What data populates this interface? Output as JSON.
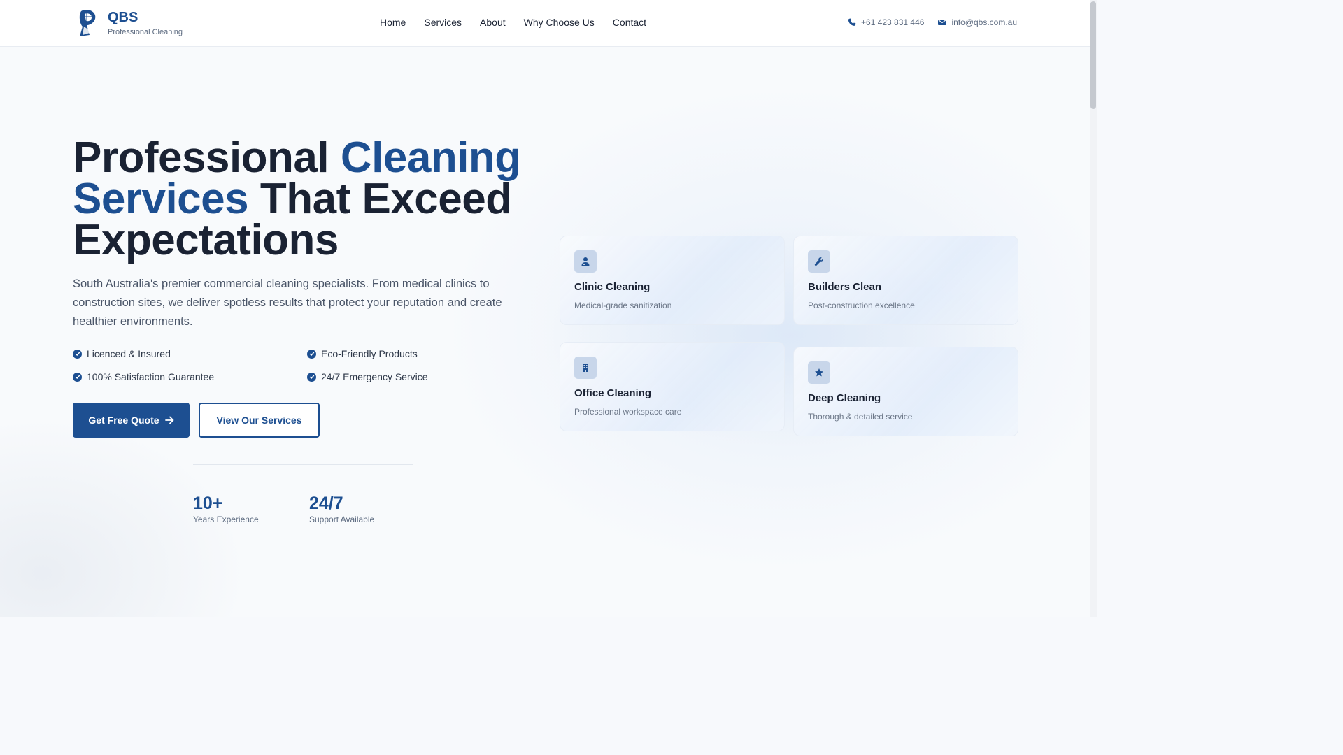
{
  "brand": {
    "name": "QBS",
    "tagline": "Professional Cleaning"
  },
  "nav": {
    "items": [
      "Home",
      "Services",
      "About",
      "Why Choose Us",
      "Contact"
    ]
  },
  "contact": {
    "phone": "+61 423 831 446",
    "email": "info@qbs.com.au"
  },
  "hero": {
    "title_part1": "Professional ",
    "title_accent": "Cleaning Services",
    "title_part2": " That Exceed Expectations",
    "description": "South Australia's premier commercial cleaning specialists. From medical clinics to construction sites, we deliver spotless results that protect your reputation and create healthier environments.",
    "features": [
      "Licenced & Insured",
      "Eco-Friendly Products",
      "100% Satisfaction Guarantee",
      "24/7 Emergency Service"
    ],
    "primary_button": "Get Free Quote",
    "secondary_button": "View Our Services"
  },
  "stats": [
    {
      "value": "10+",
      "label": "Years Experience"
    },
    {
      "value": "24/7",
      "label": "Support Available"
    }
  ],
  "service_cards": [
    {
      "title": "Clinic Cleaning",
      "description": "Medical-grade sanitization",
      "icon": "user-md-icon"
    },
    {
      "title": "Builders Clean",
      "description": "Post-construction excellence",
      "icon": "wrench-icon"
    },
    {
      "title": "Office Cleaning",
      "description": "Professional workspace care",
      "icon": "building-icon"
    },
    {
      "title": "Deep Cleaning",
      "description": "Thorough & detailed service",
      "icon": "star-icon"
    }
  ],
  "colors": {
    "brand_blue": "#1d4f91",
    "text_dark": "#1a2233",
    "text_muted": "#5d6b80"
  }
}
